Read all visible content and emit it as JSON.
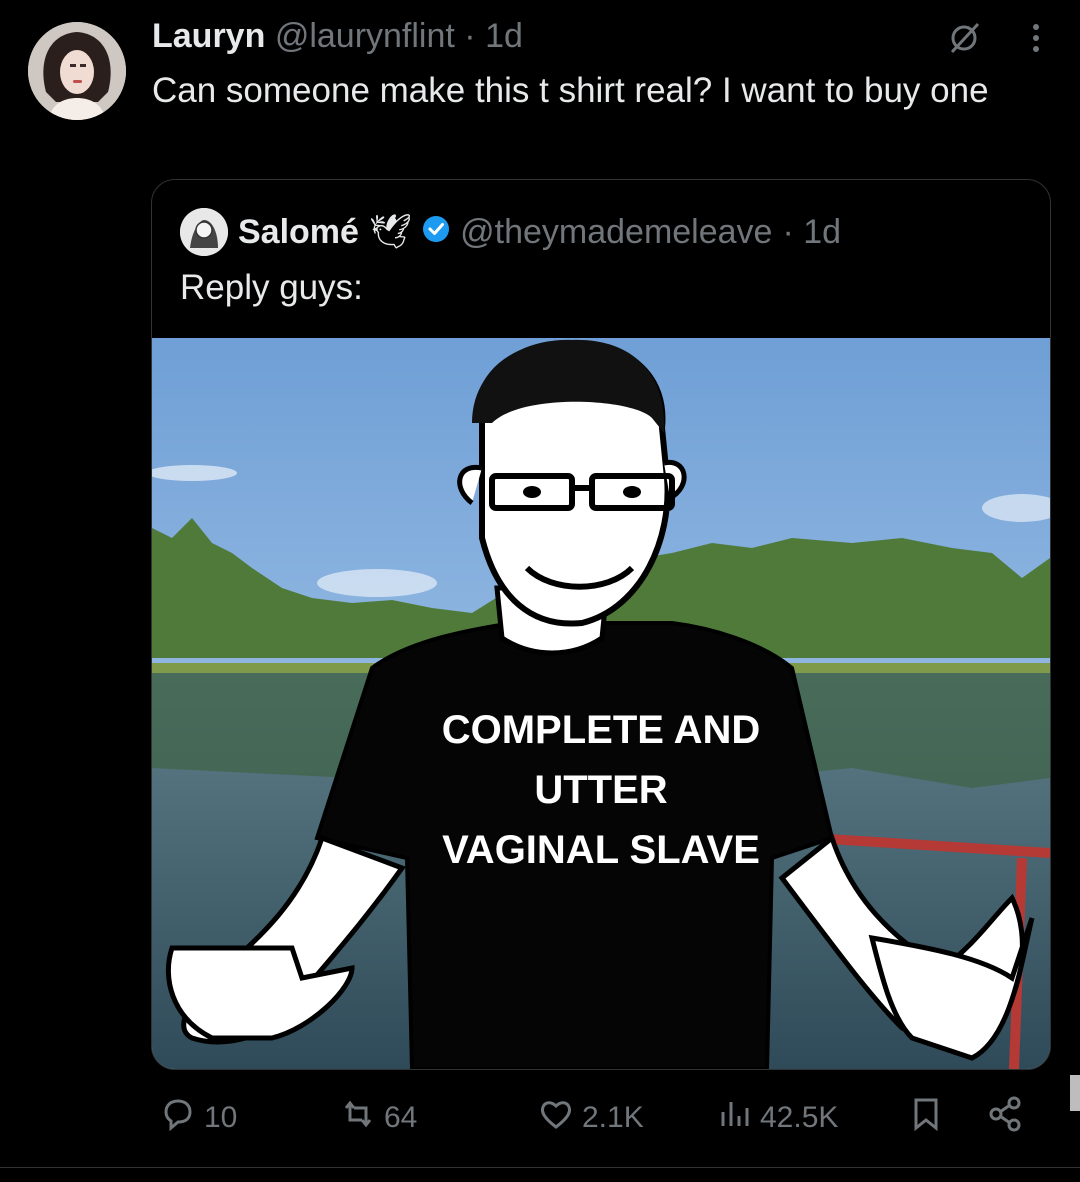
{
  "tweet": {
    "author_name": "Lauryn",
    "author_handle": "@laurynflint",
    "time": "· 1d",
    "text": "Can someone make this t shirt real? I want to buy one"
  },
  "quote": {
    "author_name": "Salomé",
    "author_emoji": "🕊",
    "handle": "@theymademeleave",
    "time": "· 1d",
    "text": "Reply guys:",
    "image": {
      "shirt_text_lines": [
        "COMPLETE AND",
        "UTTER",
        "VAGINAL SLAVE"
      ]
    }
  },
  "actions": {
    "replies": "10",
    "reposts": "64",
    "likes": "2.1K",
    "views": "42.5K"
  },
  "colors": {
    "background": "#000000",
    "text": "#e7e9ea",
    "muted": "#71767b",
    "verified": "#1d9bf0"
  },
  "icons": [
    "grok-icon",
    "more-icon",
    "reply-icon",
    "repost-icon",
    "like-icon",
    "views-icon",
    "bookmark-icon",
    "share-icon",
    "verified-badge-icon"
  ]
}
